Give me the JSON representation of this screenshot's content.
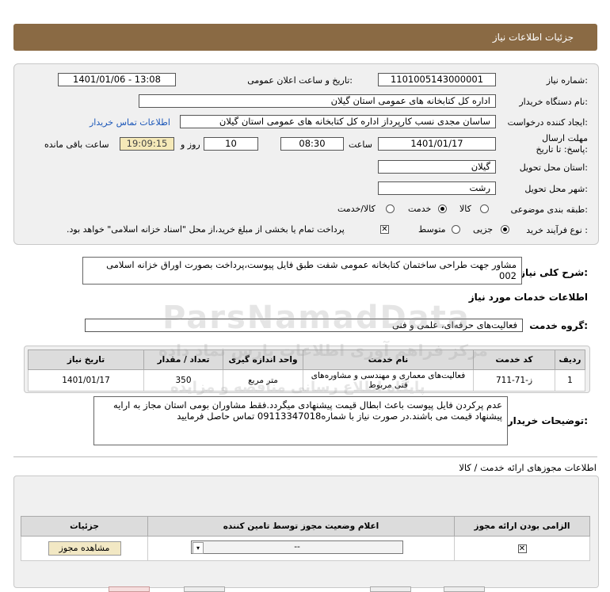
{
  "header": {
    "title": "جزئیات اطلاعات نیاز"
  },
  "form": {
    "need_number": {
      "label": "شماره نیاز:",
      "value": "1101005143000001"
    },
    "announce_datetime": {
      "label": "تاریخ و ساعت اعلان عمومی:",
      "value": "1401/01/06 - 13:08"
    },
    "buyer_org": {
      "label": "نام دستگاه خریدار:",
      "value": "اداره کل کتابخانه های عمومی استان گیلان"
    },
    "requester": {
      "label": "ایجاد کننده درخواست:",
      "value": "ساسان مجدی نسب کارپرداز اداره کل کتابخانه های عمومی استان گیلان",
      "contact_link": "اطلاعات تماس خریدار"
    },
    "deadline": {
      "label": "مهلت ارسال پاسخ: تا تاریخ:",
      "date": "1401/01/17",
      "time_label": "ساعت",
      "time": "08:30",
      "days": "10",
      "days_label": "روز و",
      "remaining": "19:09:15",
      "remaining_label": "ساعت باقی مانده"
    },
    "delivery_province": {
      "label": "استان محل تحویل:",
      "value": "گیلان"
    },
    "delivery_city": {
      "label": "شهر محل تحویل:",
      "value": "رشت"
    },
    "category": {
      "label": "طبقه بندی موضوعی:",
      "options": [
        "کالا",
        "خدمت",
        "کالا/خدمت"
      ],
      "selected": "خدمت"
    },
    "process": {
      "label": "نوع فرآیند خرید :",
      "options": [
        "جزیی",
        "متوسط"
      ],
      "selected": "جزیی",
      "note": "پرداخت تمام یا بخشی از مبلغ خرید،از محل \"اسناد خزانه اسلامی\" خواهد بود."
    }
  },
  "summary": {
    "label": "شرح کلی نیاز:",
    "text": "مشاور جهت طراحی ساختمان کتابخانه عمومی شفت طبق فایل پیوست،پرداخت بصورت اوراق خزانه اسلامی 002"
  },
  "services": {
    "section_title": "اطلاعات خدمات مورد نیاز",
    "group_label": "گروه خدمت:",
    "group_value": "فعالیت‌های حرفه‌ای، علمی و فنی",
    "columns": [
      "ردیف",
      "کد خدمت",
      "نام خدمت",
      "واحد اندازه گیری",
      "تعداد / مقدار",
      "تاریخ نیاز"
    ],
    "rows": [
      [
        "1",
        "ز-71-711",
        "فعالیت‌های معماری و مهندسی و مشاوره‌های فنی مربوط",
        "متر مربع",
        "350",
        "1401/01/17"
      ]
    ]
  },
  "buyer_notes": {
    "label": "توضیحات خریدار:",
    "text": "عدم پرکردن فایل پیوست باعث ابطال قیمت پیشنهادی میگردد.فقط مشاوران بومی استان مجاز به ارایه پیشنهاد قیمت می باشند.در صورت نیاز با شماره09113347018 تماس حاصل فرمایید"
  },
  "permits": {
    "section_title": "اطلاعات مجوزهای ارائه خدمت / کالا",
    "columns": [
      "الزامی بودن ارائه مجوز",
      "اعلام وضعیت مجوز توسط تامین کننده",
      "جزئیات"
    ],
    "status_value": "--",
    "view_button": "مشاهده مجوز"
  },
  "watermark": {
    "line1": "ParsNamadData",
    "line2": "مرکز فراهم آوری اطلاعات پارس نماد داده",
    "line3": "پایگاه اطلاع رسانی مناقصه و مزایده"
  }
}
